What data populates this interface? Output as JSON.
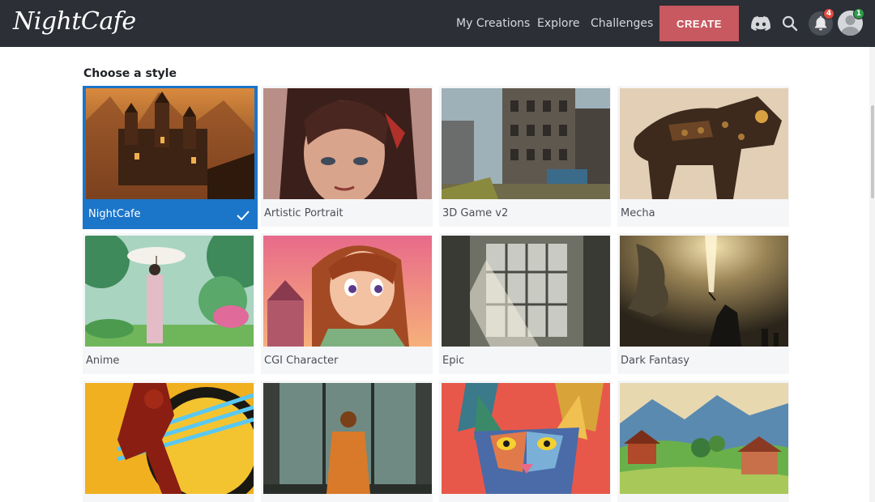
{
  "header": {
    "logo": "NightCafe",
    "nav": [
      "My Creations",
      "Explore",
      "Challenges"
    ],
    "create_label": "CREATE",
    "notification_count": "4",
    "avatar_badge": "1"
  },
  "page": {
    "heading": "Choose a style"
  },
  "styles": [
    {
      "label": "NightCafe",
      "selected": true
    },
    {
      "label": "Artistic Portrait",
      "selected": false
    },
    {
      "label": "3D Game v2",
      "selected": false
    },
    {
      "label": "Mecha",
      "selected": false
    },
    {
      "label": "Anime",
      "selected": false
    },
    {
      "label": "CGI Character",
      "selected": false
    },
    {
      "label": "Epic",
      "selected": false
    },
    {
      "label": "Dark Fantasy",
      "selected": false
    },
    {
      "label": "",
      "selected": false
    },
    {
      "label": "",
      "selected": false
    },
    {
      "label": "",
      "selected": false
    },
    {
      "label": "",
      "selected": false
    }
  ],
  "colors": {
    "header_bg": "#2c2f35",
    "create_bg": "#c85961",
    "selected_bg": "#1b75c9",
    "notif_badge": "#e04b3f",
    "avatar_badge": "#2e9a4a"
  },
  "icons": [
    "discord-icon",
    "search-icon",
    "bell-icon",
    "avatar-icon",
    "check-icon"
  ]
}
